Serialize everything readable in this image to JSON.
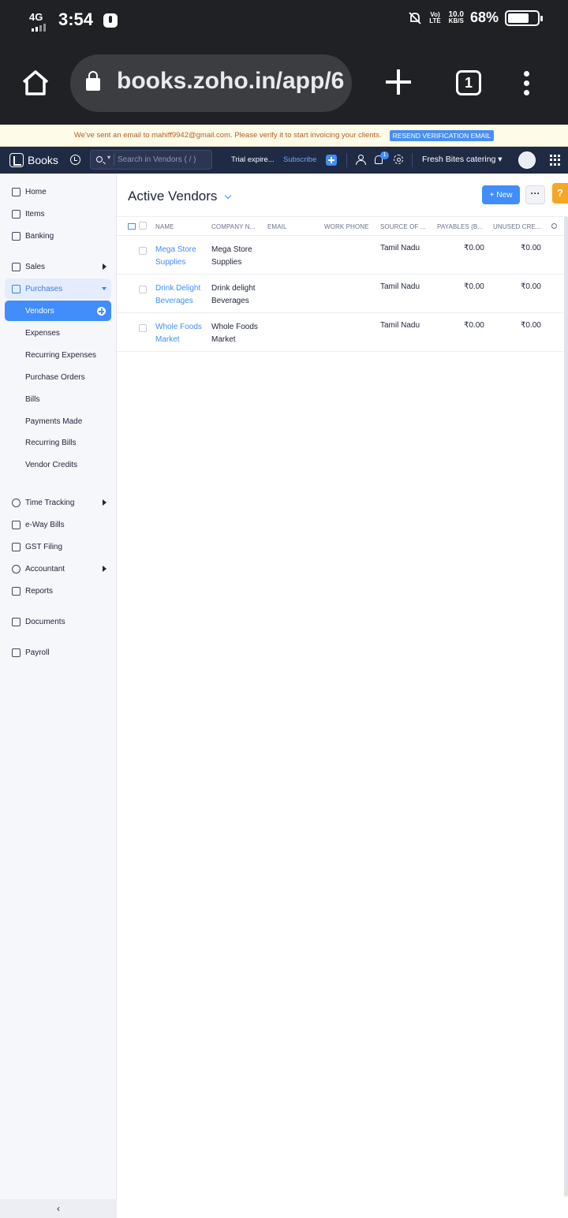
{
  "status_bar": {
    "network": "4G",
    "time": "3:54",
    "volte": "Vo) LTE",
    "speed_value": "10.0",
    "speed_unit": "KB/S",
    "battery_pct": "68%"
  },
  "browser": {
    "url": "books.zoho.in/app/6",
    "tab_count": "1"
  },
  "banner": {
    "message": "We've sent an email to mahiff9942@gmail.com. Please verify it to start invoicing your clients.",
    "resend_label": "RESEND VERIFICATION EMAIL"
  },
  "topnav": {
    "app_name": "Books",
    "search_placeholder": "Search in Vendors ( / )",
    "trial_label": "Trial expire...",
    "subscribe_label": "Subscribe",
    "notification_count": "1",
    "org_name": "Fresh Bites catering"
  },
  "sidebar": {
    "items": [
      {
        "label": "Home",
        "icon": "home-icon"
      },
      {
        "label": "Items",
        "icon": "items-icon"
      },
      {
        "label": "Banking",
        "icon": "bank-icon"
      },
      {
        "label": "Sales",
        "icon": "cart-icon"
      },
      {
        "label": "Purchases",
        "icon": "bag-icon"
      },
      {
        "label": "Vendors"
      },
      {
        "label": "Expenses"
      },
      {
        "label": "Recurring Expenses"
      },
      {
        "label": "Purchase Orders"
      },
      {
        "label": "Bills"
      },
      {
        "label": "Payments Made"
      },
      {
        "label": "Recurring Bills"
      },
      {
        "label": "Vendor Credits"
      },
      {
        "label": "Time Tracking",
        "icon": "clock-icon"
      },
      {
        "label": "e-Way Bills",
        "icon": "truck-icon"
      },
      {
        "label": "GST Filing",
        "icon": "gst-icon"
      },
      {
        "label": "Accountant",
        "icon": "accountant-icon"
      },
      {
        "label": "Reports",
        "icon": "reports-icon"
      },
      {
        "label": "Documents",
        "icon": "folder-icon"
      },
      {
        "label": "Payroll",
        "icon": "payroll-icon"
      }
    ],
    "collapse_label": "‹"
  },
  "main": {
    "title": "Active Vendors",
    "new_label": "New",
    "more_label": "···",
    "help_label": "?",
    "columns": [
      "NAME",
      "COMPANY N...",
      "EMAIL",
      "WORK PHONE",
      "SOURCE OF ...",
      "PAYABLES (B...",
      "UNUSED CRE..."
    ],
    "rows": [
      {
        "name": "Mega Store Supplies",
        "company": "Mega Store Supplies",
        "email": "",
        "phone": "",
        "source": "Tamil Nadu",
        "payables": "₹0.00",
        "unused": "₹0.00"
      },
      {
        "name": "Drink Delight Beverages",
        "company": "Drink delight Beverages",
        "email": "",
        "phone": "",
        "source": "Tamil Nadu",
        "payables": "₹0.00",
        "unused": "₹0.00"
      },
      {
        "name": "Whole Foods Market",
        "company": "Whole Foods Market",
        "email": "",
        "phone": "",
        "source": "Tamil Nadu",
        "payables": "₹0.00",
        "unused": "₹0.00"
      }
    ]
  }
}
